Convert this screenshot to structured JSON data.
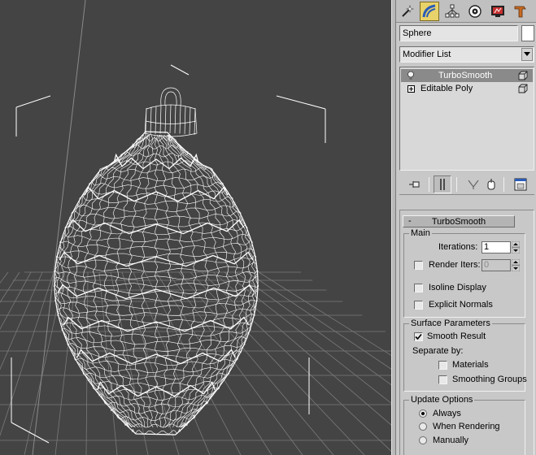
{
  "panel": {
    "tabs": [
      {
        "id": "create",
        "icon": "create-icon"
      },
      {
        "id": "modify",
        "icon": "modify-icon",
        "active": true
      },
      {
        "id": "hierarchy",
        "icon": "hierarchy-icon"
      },
      {
        "id": "motion",
        "icon": "motion-icon"
      },
      {
        "id": "display",
        "icon": "display-icon"
      },
      {
        "id": "utilities",
        "icon": "utilities-icon"
      }
    ],
    "object_name": "Sphere",
    "object_color": "#ffffff",
    "modifier_list_label": "Modifier List",
    "stack": [
      {
        "label": "TurboSmooth",
        "selected": true
      },
      {
        "label": "Editable Poly",
        "selected": false
      }
    ]
  },
  "rollout": {
    "title": "TurboSmooth",
    "main": {
      "group_label": "Main",
      "iterations_label": "Iterations:",
      "iterations_value": "1",
      "render_iters_label": "Render Iters:",
      "render_iters_value": "0",
      "render_iters_checked": false,
      "isoline_label": "Isoline Display",
      "isoline_checked": false,
      "explicit_normals_label": "Explicit Normals",
      "explicit_normals_checked": false
    },
    "surface": {
      "group_label": "Surface Parameters",
      "smooth_result_label": "Smooth Result",
      "smooth_result_checked": true,
      "separate_by_label": "Separate by:",
      "materials_label": "Materials",
      "materials_checked": false,
      "smoothing_groups_label": "Smoothing Groups",
      "smoothing_groups_checked": false
    },
    "update": {
      "group_label": "Update Options",
      "options": [
        {
          "label": "Always",
          "selected": true
        },
        {
          "label": "When Rendering",
          "selected": false
        },
        {
          "label": "Manually",
          "selected": false
        }
      ]
    }
  },
  "colors": {
    "viewport_bg": "#444444",
    "panel_bg": "#c8c8c8",
    "active_tab": "#e8d26a",
    "wire": "#ffffff",
    "grid": "#7a7a7a"
  }
}
